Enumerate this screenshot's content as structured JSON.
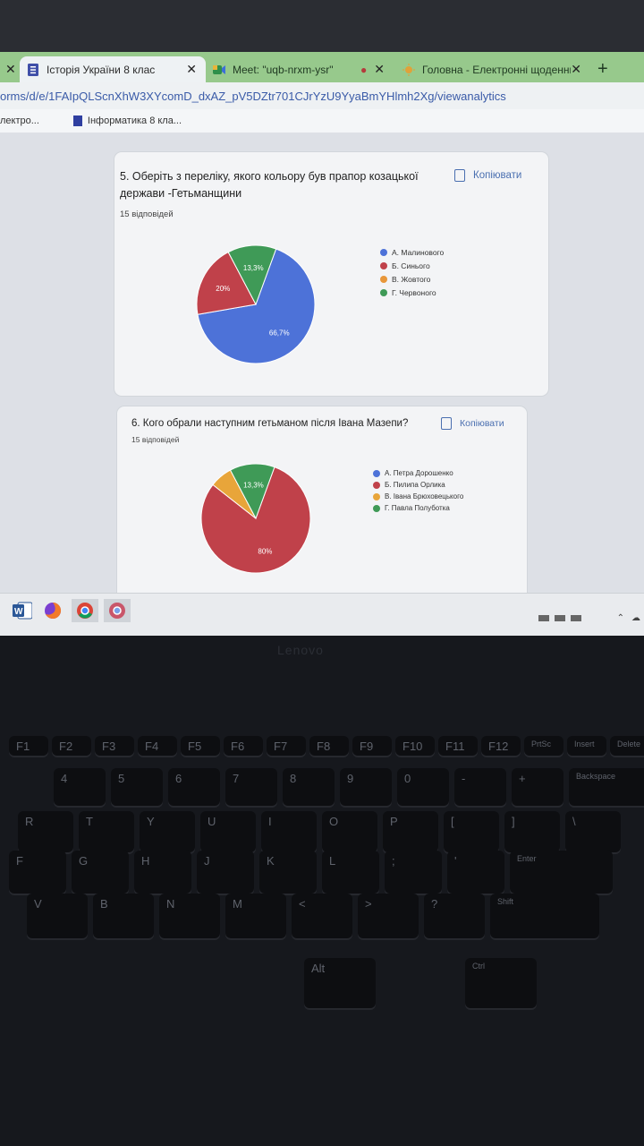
{
  "browser": {
    "tabs": [
      {
        "title": "Історія України 8 клас",
        "icon": "forms-icon",
        "active": true
      },
      {
        "title": "Meet: \"uqb-nrxm-ysr\"",
        "icon": "meet-icon",
        "active": false
      },
      {
        "title": "Головна - Електронні щоденни",
        "icon": "sun-icon",
        "active": false
      }
    ],
    "new_tab": "+",
    "url": "orms/d/e/1FAIpQLScnXhW3XYcomD_dxAZ_pV5DZtr701CJrYzU9YyaBmYHlmh2Xg/viewanalytics",
    "bookmarks": [
      {
        "label": "лектро..."
      },
      {
        "label": "Інформатика 8 кла..."
      }
    ]
  },
  "questions": [
    {
      "title": "5. Оберіть з переліку, якого кольору був прапор козацької держави -Гетьманщини",
      "count": "15 відповідей",
      "copy_label": "Копіювати",
      "legend": [
        {
          "label": "А. Малинового",
          "color": "#4d72d8"
        },
        {
          "label": "Б. Синього",
          "color": "#c0414a"
        },
        {
          "label": "В. Жовтого",
          "color": "#e8973a"
        },
        {
          "label": "Г. Червоного",
          "color": "#3f9a57"
        }
      ],
      "slices": [
        66.7,
        20,
        0,
        13.3
      ],
      "labels": [
        "66,7%",
        "20%",
        "",
        "13,3%"
      ]
    },
    {
      "title": "6. Кого обрали наступним гетьманом після Івана Мазепи?",
      "count": "15 відповідей",
      "copy_label": "Копіювати",
      "legend": [
        {
          "label": "А. Петра Дорошенко",
          "color": "#4d72d8"
        },
        {
          "label": "Б. Пилипа Орлика",
          "color": "#c0414a"
        },
        {
          "label": "В. Івана Брюховецького",
          "color": "#e8a53a"
        },
        {
          "label": "Г. Павла Полуботка",
          "color": "#3f9a57"
        }
      ],
      "slices": [
        0,
        80,
        6.7,
        13.3
      ],
      "labels": [
        "",
        "80%",
        "",
        "13,3%"
      ]
    }
  ],
  "keyboard": {
    "brand": "Lenovo",
    "row_fn": [
      "F1",
      "F2",
      "F3",
      "F4",
      "F5",
      "F6",
      "F7",
      "F8",
      "F9",
      "F10",
      "F11",
      "F12",
      "PrtSc",
      "Insert",
      "Delete"
    ],
    "row_num": [
      "4",
      "5",
      "6",
      "7",
      "8",
      "9",
      "0",
      "-",
      "+",
      "Backspace"
    ],
    "row_top": [
      "R",
      "T",
      "Y",
      "U",
      "I",
      "O",
      "P",
      "[",
      "]",
      "\\"
    ],
    "row_mid": [
      "F",
      "G",
      "H",
      "J",
      "K",
      "L",
      ";",
      "'",
      "Enter"
    ],
    "row_bot": [
      "V",
      "B",
      "N",
      "M",
      "<",
      ">",
      "?",
      "Shift"
    ],
    "row_space": [
      "Alt",
      "Ctrl"
    ]
  }
}
